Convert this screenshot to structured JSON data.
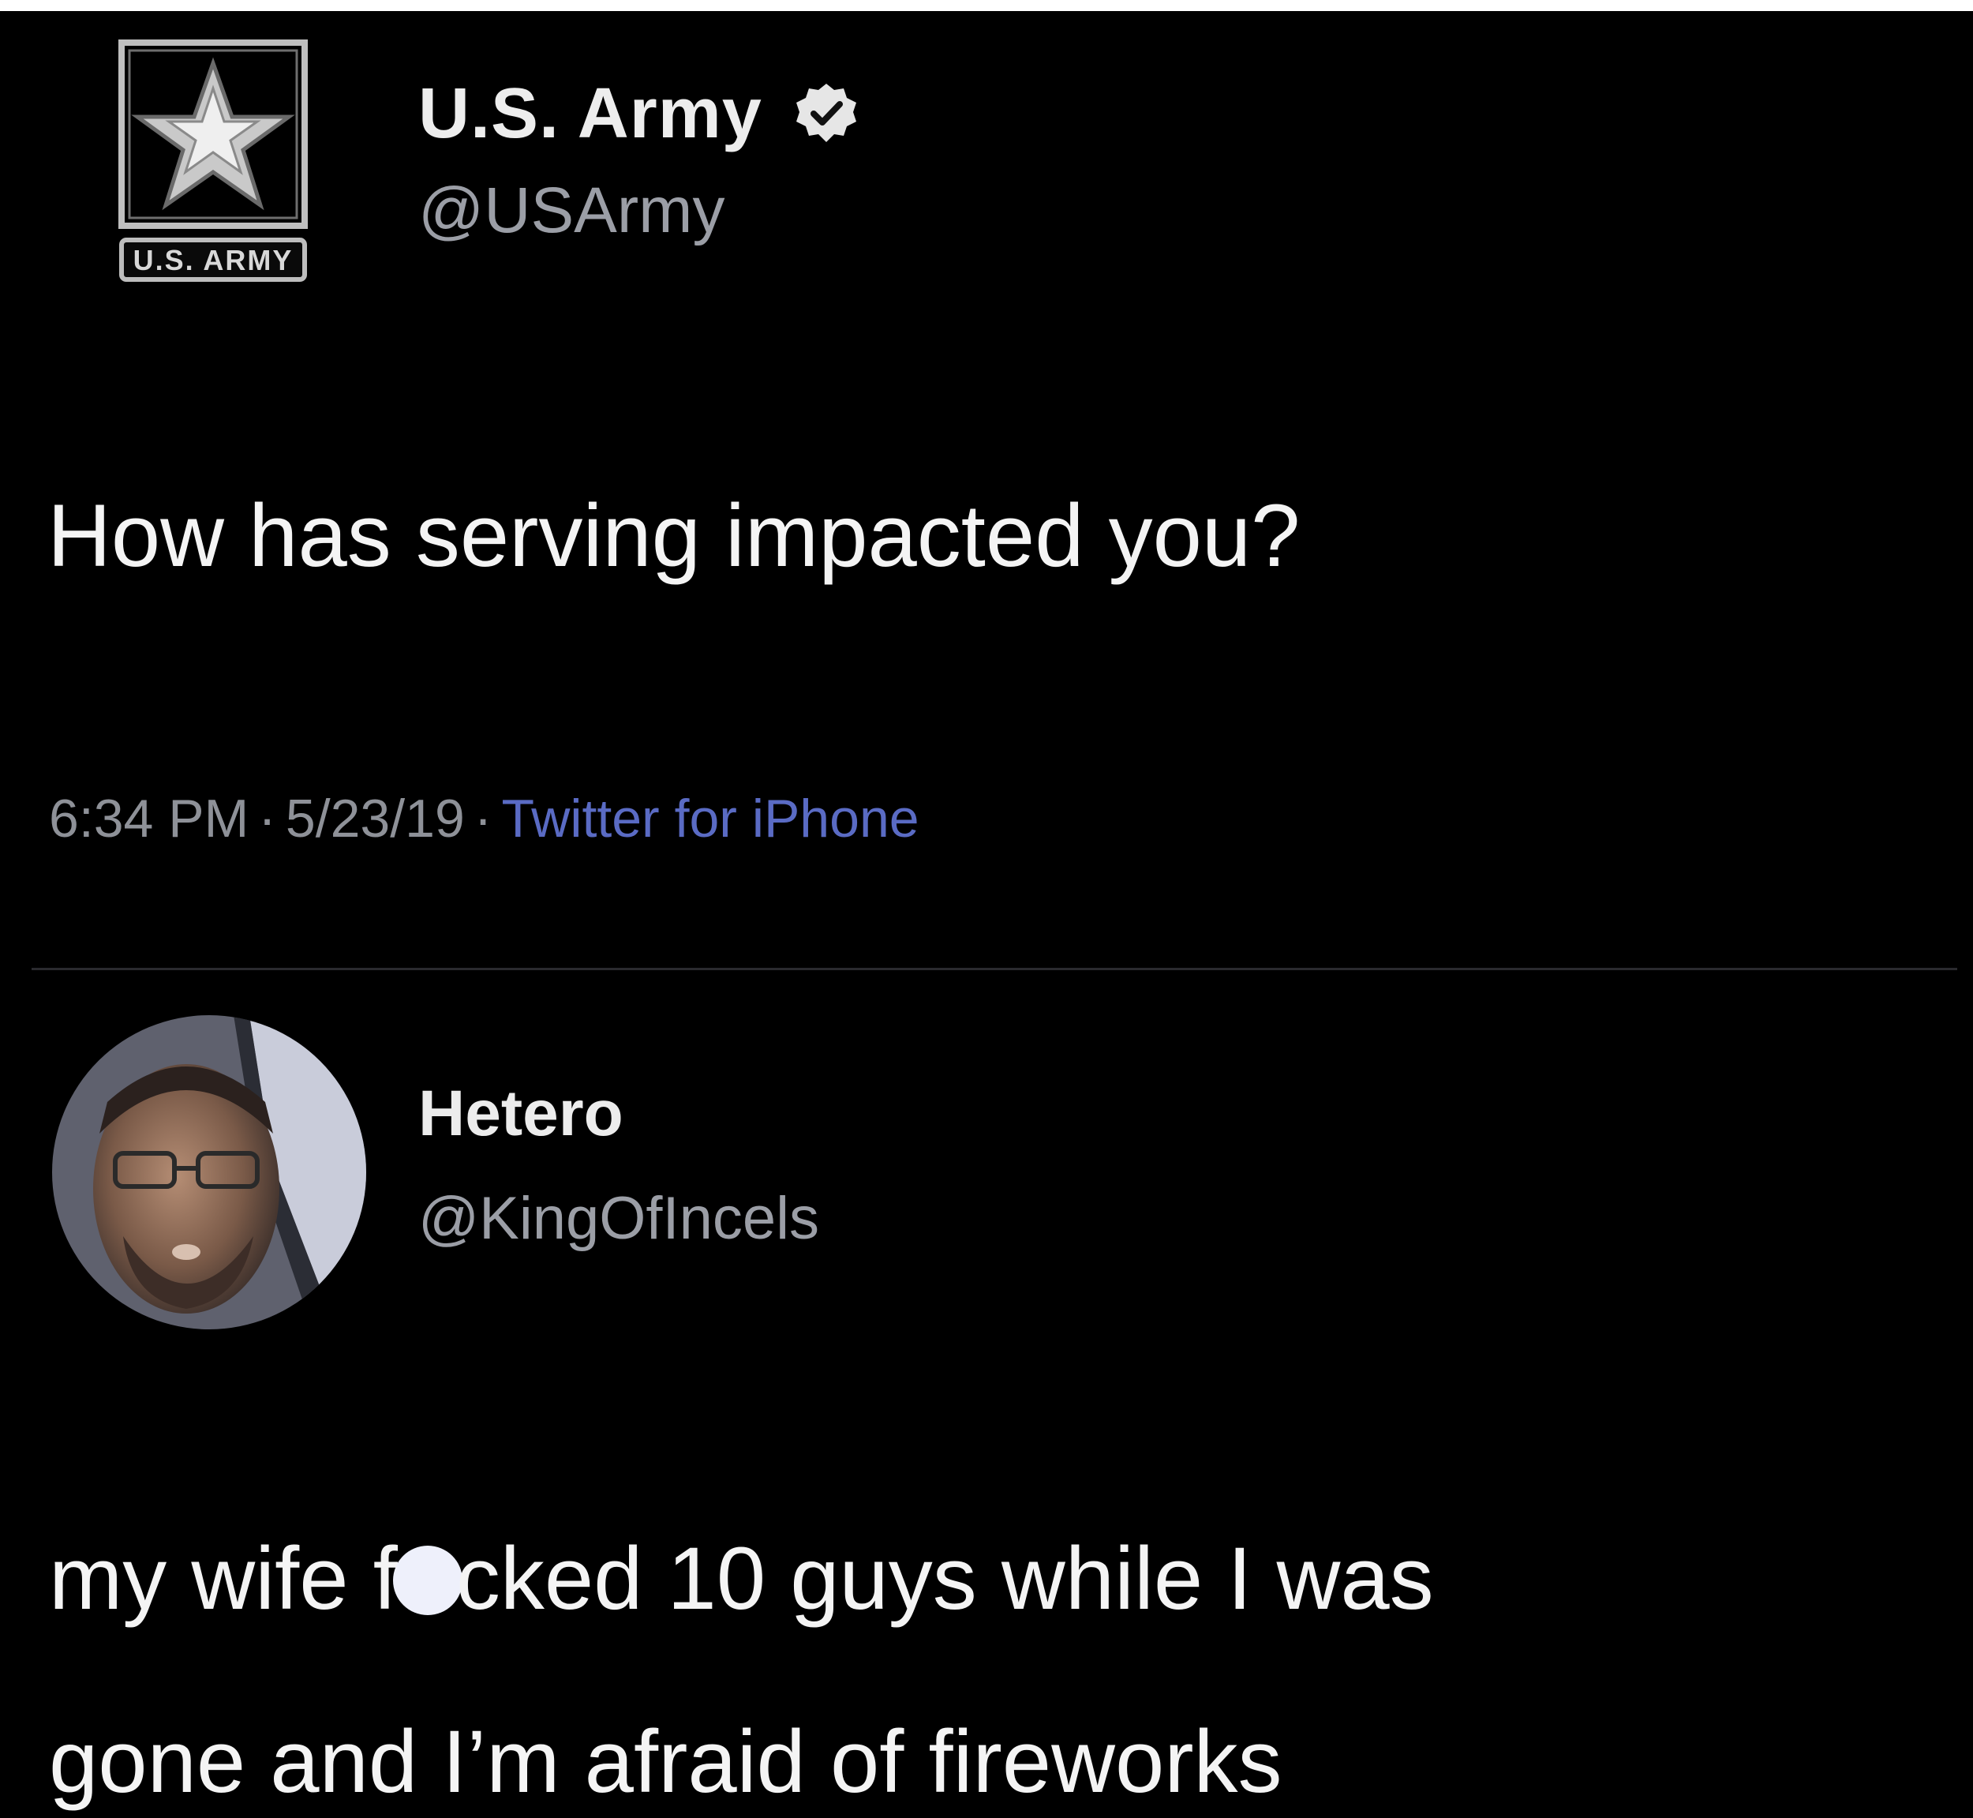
{
  "tweet": {
    "author_name": "U.S. Army",
    "author_handle": "@USArmy",
    "verified_icon": "verified-badge-icon",
    "logo_icon": "us-army-star-logo",
    "logo_text": "U.S. ARMY",
    "text": "How has serving impacted you?",
    "time": "6:34 PM",
    "date": "5/23/19",
    "separator": "·",
    "source": "Twitter for iPhone"
  },
  "reply": {
    "author_name": "Hetero",
    "author_handle": "@KingOfIncels",
    "avatar_icon": "profile-photo",
    "text_line1_before": "my wife f",
    "text_line1_after": "cked 10 guys while I was",
    "text_line2": "gone and I’m afraid of fireworks"
  },
  "colors": {
    "background": "#000000",
    "text_primary": "#f4f4f4",
    "text_secondary": "#9b9ea6",
    "link": "#5a6bc4",
    "censor_dot": "#eef0fb"
  }
}
